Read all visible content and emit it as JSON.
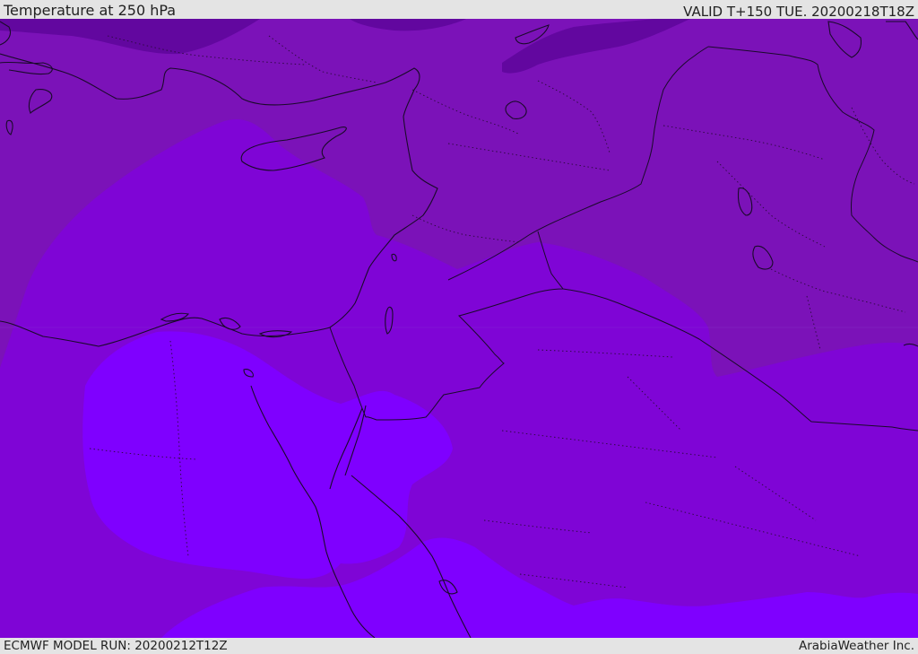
{
  "header": {
    "title": "Temperature at 250 hPa",
    "valid": "VALID T+150 TUE. 20200218T18Z"
  },
  "footer": {
    "model_run": "ECMWF MODEL RUN: 20200212T12Z",
    "credit": "ArabiaWeather Inc."
  },
  "colors": {
    "band_darkest": "#62079f",
    "band_dark": "#7b12b8",
    "band_mid": "#7f05d6",
    "band_light": "#7f00ff",
    "coastline": "#1a0a2a",
    "border": "#1a0a2a",
    "bar_background": "#e4e4e4"
  }
}
